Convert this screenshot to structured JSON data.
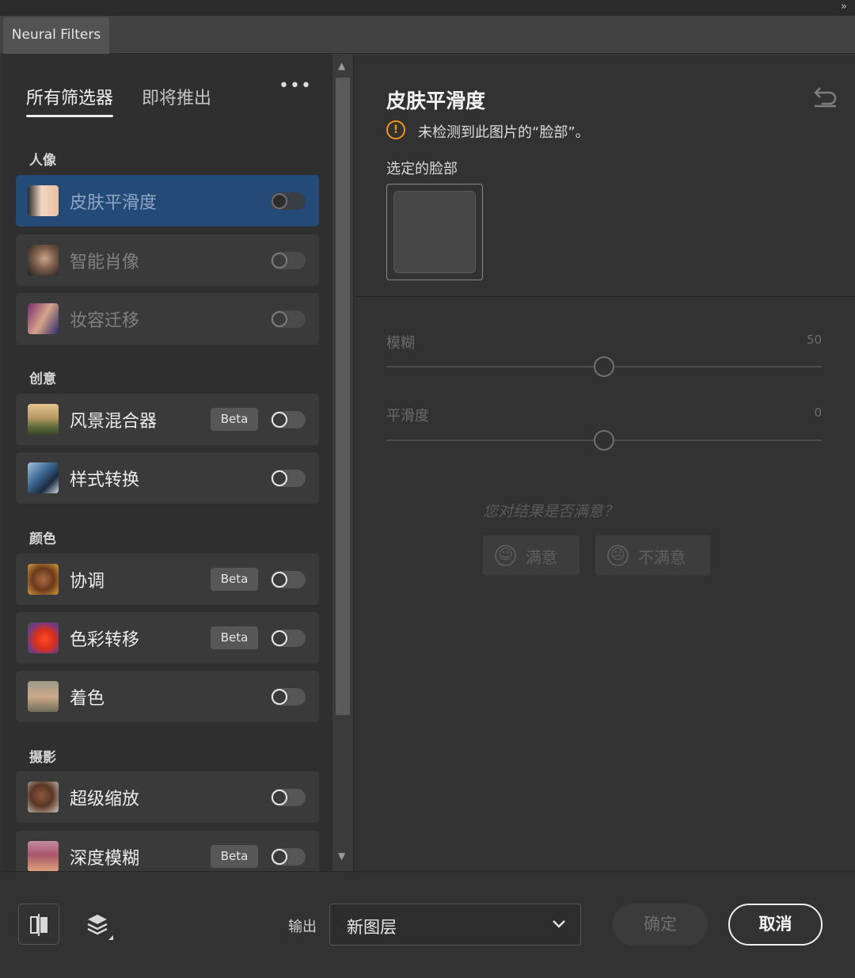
{
  "panel": {
    "tab_title": "Neural Filters",
    "collapse_glyph": "»"
  },
  "filters_panel": {
    "tabs": [
      {
        "label": "所有筛选器",
        "active": true
      },
      {
        "label": "即将推出",
        "active": false
      }
    ],
    "more_glyph": "•••",
    "sections": [
      {
        "title": "人像",
        "items": [
          {
            "name": "皮肤平滑度",
            "beta": false,
            "enabled": false,
            "state": "selected",
            "thumb": "face-skin"
          },
          {
            "name": "智能肖像",
            "beta": false,
            "enabled": false,
            "state": "unavailable",
            "thumb": "portrait"
          },
          {
            "name": "妆容迁移",
            "beta": false,
            "enabled": false,
            "state": "unavailable",
            "thumb": "makeup"
          }
        ]
      },
      {
        "title": "创意",
        "items": [
          {
            "name": "风景混合器",
            "beta": true,
            "enabled": false,
            "state": "normal",
            "thumb": "landscape"
          },
          {
            "name": "样式转换",
            "beta": false,
            "enabled": false,
            "state": "normal",
            "thumb": "painting"
          }
        ]
      },
      {
        "title": "颜色",
        "items": [
          {
            "name": "协调",
            "beta": true,
            "enabled": false,
            "state": "normal",
            "thumb": "harmony"
          },
          {
            "name": "色彩转移",
            "beta": true,
            "enabled": false,
            "state": "normal",
            "thumb": "flower"
          },
          {
            "name": "着色",
            "beta": false,
            "enabled": false,
            "state": "normal",
            "thumb": "old-photo"
          }
        ]
      },
      {
        "title": "摄影",
        "items": [
          {
            "name": "超级缩放",
            "beta": false,
            "enabled": false,
            "state": "normal",
            "thumb": "glasses-man"
          },
          {
            "name": "深度模糊",
            "beta": true,
            "enabled": false,
            "state": "normal",
            "thumb": "sunset"
          }
        ]
      }
    ],
    "beta_label": "Beta"
  },
  "detail": {
    "title": "皮肤平滑度",
    "warning": "未检测到此图片的“脸部”。",
    "face_label": "选定的脸部",
    "sliders": [
      {
        "label": "模糊",
        "value": 50
      },
      {
        "label": "平滑度",
        "value": 0
      }
    ],
    "feedback": {
      "question": "您对结果是否满意？",
      "yes": "满意",
      "no": "不满意"
    }
  },
  "footer": {
    "output_label": "输出",
    "output_value": "新图层",
    "ok_label": "确定",
    "cancel_label": "取消"
  },
  "colors": {
    "accent_selected": "#244a78",
    "warning": "#f29423"
  }
}
